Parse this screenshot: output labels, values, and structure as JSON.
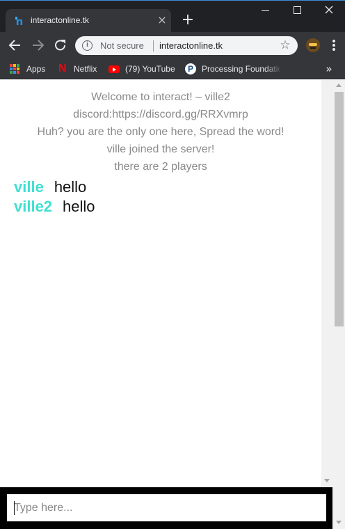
{
  "browser": {
    "tab": {
      "title": "interactonline.tk",
      "close_glyph": "×"
    },
    "new_tab_glyph": "+",
    "omnibox": {
      "security_label": "Not secure",
      "url": "interactonline.tk"
    },
    "bookmarks": [
      {
        "label": "Apps",
        "icon": "apps-grid-icon"
      },
      {
        "label": "Netflix",
        "icon": "netflix-icon"
      },
      {
        "label": "(79) YouTube",
        "icon": "youtube-icon"
      },
      {
        "label": "Processing Foundatio",
        "icon": "processing-icon"
      }
    ],
    "bookmarks_overflow_glyph": "»"
  },
  "chat": {
    "system_messages": [
      "Welcome to interact! – ville2",
      "discord:https://discord.gg/RRXvmrp",
      "Huh? you are the only one here, Spread the word!",
      "ville joined the server!",
      "there are 2 players"
    ],
    "messages": [
      {
        "user": "ville",
        "text": "hello"
      },
      {
        "user": "ville2",
        "text": "hello"
      }
    ],
    "input_placeholder": "Type here..."
  },
  "colors": {
    "username": "#40e0d0",
    "system_text": "#8a8a8a",
    "input_bar": "#000000",
    "chrome_dark": "#202124"
  }
}
